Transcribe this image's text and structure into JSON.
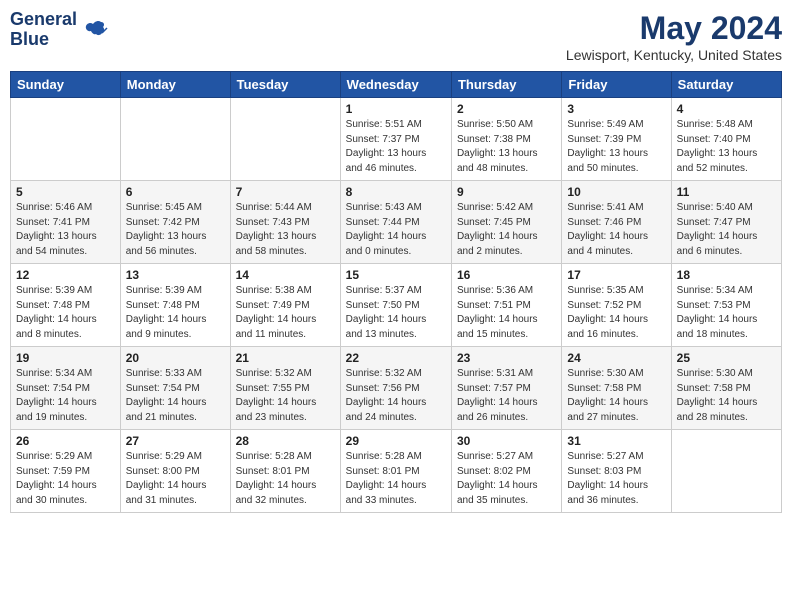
{
  "header": {
    "logo_line1": "General",
    "logo_line2": "Blue",
    "month_title": "May 2024",
    "location": "Lewisport, Kentucky, United States"
  },
  "days_of_week": [
    "Sunday",
    "Monday",
    "Tuesday",
    "Wednesday",
    "Thursday",
    "Friday",
    "Saturday"
  ],
  "weeks": [
    [
      {
        "day": "",
        "info": ""
      },
      {
        "day": "",
        "info": ""
      },
      {
        "day": "",
        "info": ""
      },
      {
        "day": "1",
        "info": "Sunrise: 5:51 AM\nSunset: 7:37 PM\nDaylight: 13 hours\nand 46 minutes."
      },
      {
        "day": "2",
        "info": "Sunrise: 5:50 AM\nSunset: 7:38 PM\nDaylight: 13 hours\nand 48 minutes."
      },
      {
        "day": "3",
        "info": "Sunrise: 5:49 AM\nSunset: 7:39 PM\nDaylight: 13 hours\nand 50 minutes."
      },
      {
        "day": "4",
        "info": "Sunrise: 5:48 AM\nSunset: 7:40 PM\nDaylight: 13 hours\nand 52 minutes."
      }
    ],
    [
      {
        "day": "5",
        "info": "Sunrise: 5:46 AM\nSunset: 7:41 PM\nDaylight: 13 hours\nand 54 minutes."
      },
      {
        "day": "6",
        "info": "Sunrise: 5:45 AM\nSunset: 7:42 PM\nDaylight: 13 hours\nand 56 minutes."
      },
      {
        "day": "7",
        "info": "Sunrise: 5:44 AM\nSunset: 7:43 PM\nDaylight: 13 hours\nand 58 minutes."
      },
      {
        "day": "8",
        "info": "Sunrise: 5:43 AM\nSunset: 7:44 PM\nDaylight: 14 hours\nand 0 minutes."
      },
      {
        "day": "9",
        "info": "Sunrise: 5:42 AM\nSunset: 7:45 PM\nDaylight: 14 hours\nand 2 minutes."
      },
      {
        "day": "10",
        "info": "Sunrise: 5:41 AM\nSunset: 7:46 PM\nDaylight: 14 hours\nand 4 minutes."
      },
      {
        "day": "11",
        "info": "Sunrise: 5:40 AM\nSunset: 7:47 PM\nDaylight: 14 hours\nand 6 minutes."
      }
    ],
    [
      {
        "day": "12",
        "info": "Sunrise: 5:39 AM\nSunset: 7:48 PM\nDaylight: 14 hours\nand 8 minutes."
      },
      {
        "day": "13",
        "info": "Sunrise: 5:39 AM\nSunset: 7:48 PM\nDaylight: 14 hours\nand 9 minutes."
      },
      {
        "day": "14",
        "info": "Sunrise: 5:38 AM\nSunset: 7:49 PM\nDaylight: 14 hours\nand 11 minutes."
      },
      {
        "day": "15",
        "info": "Sunrise: 5:37 AM\nSunset: 7:50 PM\nDaylight: 14 hours\nand 13 minutes."
      },
      {
        "day": "16",
        "info": "Sunrise: 5:36 AM\nSunset: 7:51 PM\nDaylight: 14 hours\nand 15 minutes."
      },
      {
        "day": "17",
        "info": "Sunrise: 5:35 AM\nSunset: 7:52 PM\nDaylight: 14 hours\nand 16 minutes."
      },
      {
        "day": "18",
        "info": "Sunrise: 5:34 AM\nSunset: 7:53 PM\nDaylight: 14 hours\nand 18 minutes."
      }
    ],
    [
      {
        "day": "19",
        "info": "Sunrise: 5:34 AM\nSunset: 7:54 PM\nDaylight: 14 hours\nand 19 minutes."
      },
      {
        "day": "20",
        "info": "Sunrise: 5:33 AM\nSunset: 7:54 PM\nDaylight: 14 hours\nand 21 minutes."
      },
      {
        "day": "21",
        "info": "Sunrise: 5:32 AM\nSunset: 7:55 PM\nDaylight: 14 hours\nand 23 minutes."
      },
      {
        "day": "22",
        "info": "Sunrise: 5:32 AM\nSunset: 7:56 PM\nDaylight: 14 hours\nand 24 minutes."
      },
      {
        "day": "23",
        "info": "Sunrise: 5:31 AM\nSunset: 7:57 PM\nDaylight: 14 hours\nand 26 minutes."
      },
      {
        "day": "24",
        "info": "Sunrise: 5:30 AM\nSunset: 7:58 PM\nDaylight: 14 hours\nand 27 minutes."
      },
      {
        "day": "25",
        "info": "Sunrise: 5:30 AM\nSunset: 7:58 PM\nDaylight: 14 hours\nand 28 minutes."
      }
    ],
    [
      {
        "day": "26",
        "info": "Sunrise: 5:29 AM\nSunset: 7:59 PM\nDaylight: 14 hours\nand 30 minutes."
      },
      {
        "day": "27",
        "info": "Sunrise: 5:29 AM\nSunset: 8:00 PM\nDaylight: 14 hours\nand 31 minutes."
      },
      {
        "day": "28",
        "info": "Sunrise: 5:28 AM\nSunset: 8:01 PM\nDaylight: 14 hours\nand 32 minutes."
      },
      {
        "day": "29",
        "info": "Sunrise: 5:28 AM\nSunset: 8:01 PM\nDaylight: 14 hours\nand 33 minutes."
      },
      {
        "day": "30",
        "info": "Sunrise: 5:27 AM\nSunset: 8:02 PM\nDaylight: 14 hours\nand 35 minutes."
      },
      {
        "day": "31",
        "info": "Sunrise: 5:27 AM\nSunset: 8:03 PM\nDaylight: 14 hours\nand 36 minutes."
      },
      {
        "day": "",
        "info": ""
      }
    ]
  ]
}
